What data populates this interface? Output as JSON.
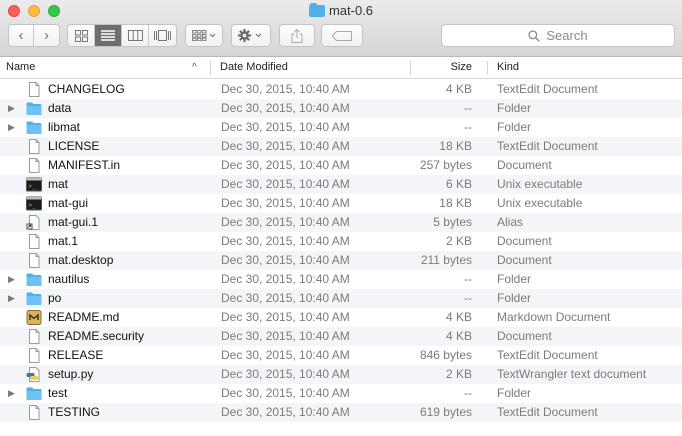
{
  "window": {
    "title": "mat-0.6"
  },
  "toolbar": {
    "back_glyph": "‹",
    "forward_glyph": "›",
    "search_placeholder": "Search"
  },
  "columns": {
    "name": "Name",
    "date": "Date Modified",
    "size": "Size",
    "kind": "Kind",
    "sort_indicator": "^"
  },
  "files": [
    {
      "name": "CHANGELOG",
      "date": "Dec 30, 2015, 10:40 AM",
      "size": "4 KB",
      "kind": "TextEdit Document",
      "icon": "document-icon",
      "folder": false
    },
    {
      "name": "data",
      "date": "Dec 30, 2015, 10:40 AM",
      "size": "--",
      "kind": "Folder",
      "icon": "folder-icon",
      "folder": true
    },
    {
      "name": "libmat",
      "date": "Dec 30, 2015, 10:40 AM",
      "size": "--",
      "kind": "Folder",
      "icon": "folder-icon",
      "folder": true
    },
    {
      "name": "LICENSE",
      "date": "Dec 30, 2015, 10:40 AM",
      "size": "18 KB",
      "kind": "TextEdit Document",
      "icon": "document-icon",
      "folder": false
    },
    {
      "name": "MANIFEST.in",
      "date": "Dec 30, 2015, 10:40 AM",
      "size": "257 bytes",
      "kind": "Document",
      "icon": "document-icon",
      "folder": false
    },
    {
      "name": "mat",
      "date": "Dec 30, 2015, 10:40 AM",
      "size": "6 KB",
      "kind": "Unix executable",
      "icon": "terminal-icon",
      "folder": false
    },
    {
      "name": "mat-gui",
      "date": "Dec 30, 2015, 10:40 AM",
      "size": "18 KB",
      "kind": "Unix executable",
      "icon": "terminal-icon",
      "folder": false
    },
    {
      "name": "mat-gui.1",
      "date": "Dec 30, 2015, 10:40 AM",
      "size": "5 bytes",
      "kind": "Alias",
      "icon": "alias-icon",
      "folder": false
    },
    {
      "name": "mat.1",
      "date": "Dec 30, 2015, 10:40 AM",
      "size": "2 KB",
      "kind": "Document",
      "icon": "document-icon",
      "folder": false
    },
    {
      "name": "mat.desktop",
      "date": "Dec 30, 2015, 10:40 AM",
      "size": "211 bytes",
      "kind": "Document",
      "icon": "document-icon",
      "folder": false
    },
    {
      "name": "nautilus",
      "date": "Dec 30, 2015, 10:40 AM",
      "size": "--",
      "kind": "Folder",
      "icon": "folder-icon",
      "folder": true
    },
    {
      "name": "po",
      "date": "Dec 30, 2015, 10:40 AM",
      "size": "--",
      "kind": "Folder",
      "icon": "folder-icon",
      "folder": true
    },
    {
      "name": "README.md",
      "date": "Dec 30, 2015, 10:40 AM",
      "size": "4 KB",
      "kind": "Markdown Document",
      "icon": "markdown-icon",
      "folder": false
    },
    {
      "name": "README.security",
      "date": "Dec 30, 2015, 10:40 AM",
      "size": "4 KB",
      "kind": "Document",
      "icon": "document-icon",
      "folder": false
    },
    {
      "name": "RELEASE",
      "date": "Dec 30, 2015, 10:40 AM",
      "size": "846 bytes",
      "kind": "TextEdit Document",
      "icon": "document-icon",
      "folder": false
    },
    {
      "name": "setup.py",
      "date": "Dec 30, 2015, 10:40 AM",
      "size": "2 KB",
      "kind": "TextWrangler text document",
      "icon": "python-script-icon",
      "folder": false
    },
    {
      "name": "test",
      "date": "Dec 30, 2015, 10:40 AM",
      "size": "--",
      "kind": "Folder",
      "icon": "folder-icon",
      "folder": true
    },
    {
      "name": "TESTING",
      "date": "Dec 30, 2015, 10:40 AM",
      "size": "619 bytes",
      "kind": "TextEdit Document",
      "icon": "document-icon",
      "folder": false
    }
  ],
  "colors": {
    "folder": "#4fb0ea",
    "row_alt": "#f3f5f8",
    "secondary_text": "#7b7b7b"
  }
}
